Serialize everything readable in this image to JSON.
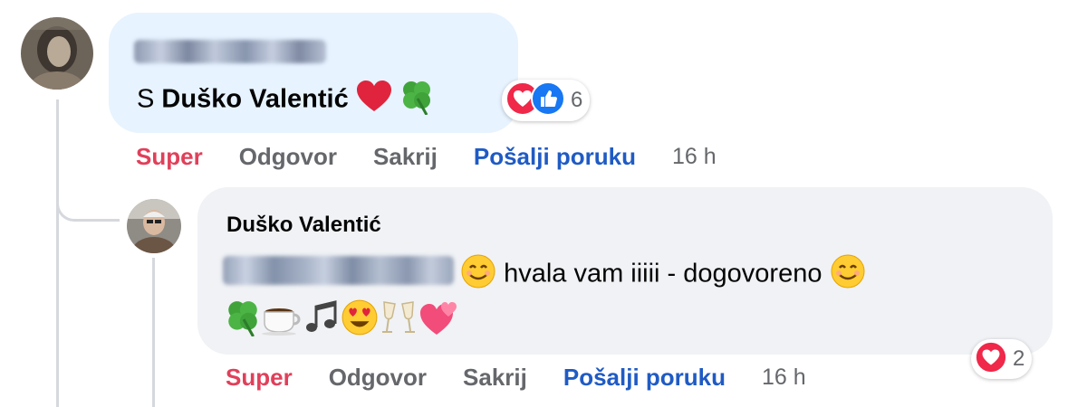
{
  "comment1": {
    "author_blurred": "Mirjana Moravec",
    "prefix": "S ",
    "mention": "Duško Valentić",
    "emojis": "❤️🍀",
    "reaction_count": "6",
    "actions": {
      "super": "Super",
      "reply": "Odgovor",
      "hide": "Sakrij",
      "message": "Pošalji poruku"
    },
    "time": "16 h"
  },
  "comment2": {
    "author": "Duško Valentić",
    "mention_blurred": "Mirjana Moravec",
    "text": "hvala vam iiiii - dogovoreno",
    "line2_emojis": "🍀☕🎶😍🥂💕",
    "reaction_count": "2",
    "actions": {
      "super": "Super",
      "reply": "Odgovor",
      "hide": "Sakrij",
      "message": "Pošalji poruku"
    },
    "time": "16 h"
  },
  "colors": {
    "bubble1": "#e7f3ff",
    "bubble2": "#f0f2f5",
    "super": "#e0405a",
    "link": "#1f5bc4",
    "muted": "#65676b"
  },
  "icons": {
    "love_reaction": "heart-reaction-icon",
    "like_reaction": "thumbs-up-reaction-icon"
  }
}
